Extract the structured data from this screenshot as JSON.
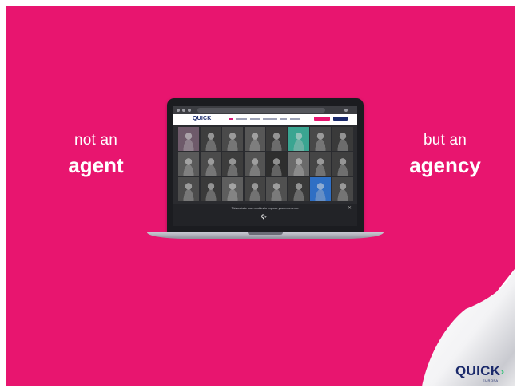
{
  "colors": {
    "background": "#e8156f",
    "brand_navy": "#1b2a6b",
    "accent_pink": "#d81b7a",
    "arrow_green": "#37c37a",
    "arrow_purple": "#7a2fc5"
  },
  "tagline": {
    "left_small": "not an",
    "left_big": "agent",
    "right_small": "but an",
    "right_big": "agency"
  },
  "laptop": {
    "site_logo": "QUICK",
    "tiles": [
      "#6e5a6a",
      "#3e3e3e",
      "#4a4a4a",
      "#575757",
      "#3b3b3b",
      "#2d2d2d",
      "#484848",
      "#3a3a3a",
      "#5a5a5a",
      "#4b4b4b",
      "#3d3d3d",
      "#535353",
      "#2e2e2e",
      "#6a6a6a",
      "#454545",
      "#3f3f3f",
      "#4c4c4c",
      "#3a3a3a",
      "#5e5e5e",
      "#444444",
      "#505050",
      "#393939",
      "#2f6fc4",
      "#474747"
    ],
    "tile_highlight_teal": "#3aa591",
    "cookie_text": "This website uses cookies to improve your experience."
  },
  "brand": {
    "name": "QUICK",
    "sub": "EUROPA"
  }
}
